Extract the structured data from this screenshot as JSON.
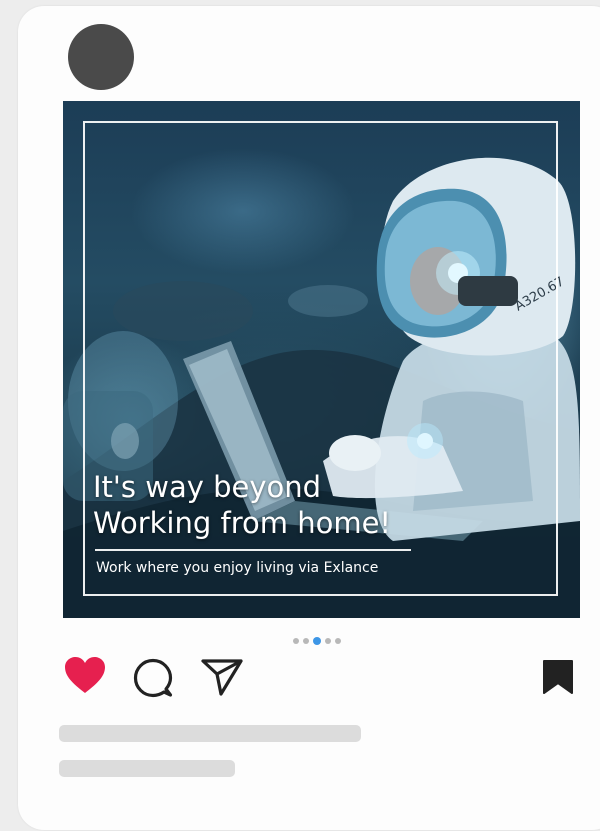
{
  "post": {
    "headline_line1": "It's way beyond",
    "headline_line2": "Working from home!",
    "subline": "Work where you enjoy living via Exlance",
    "image_alt": "Astronaut working on a laptop on the moon",
    "helmet_label": "A320.67"
  },
  "carousel": {
    "total": 5,
    "active_index": 2
  },
  "actions": {
    "like_icon": "heart-icon",
    "comment_icon": "comment-icon",
    "share_icon": "paper-plane-icon",
    "bookmark_icon": "bookmark-icon"
  },
  "colors": {
    "like": "#e6204f",
    "icon": "#222222",
    "active_dot": "#3d96e6",
    "inactive_dot": "#b8b8b8",
    "avatar": "#4a4a4a",
    "skeleton": "#dcdcdc"
  }
}
